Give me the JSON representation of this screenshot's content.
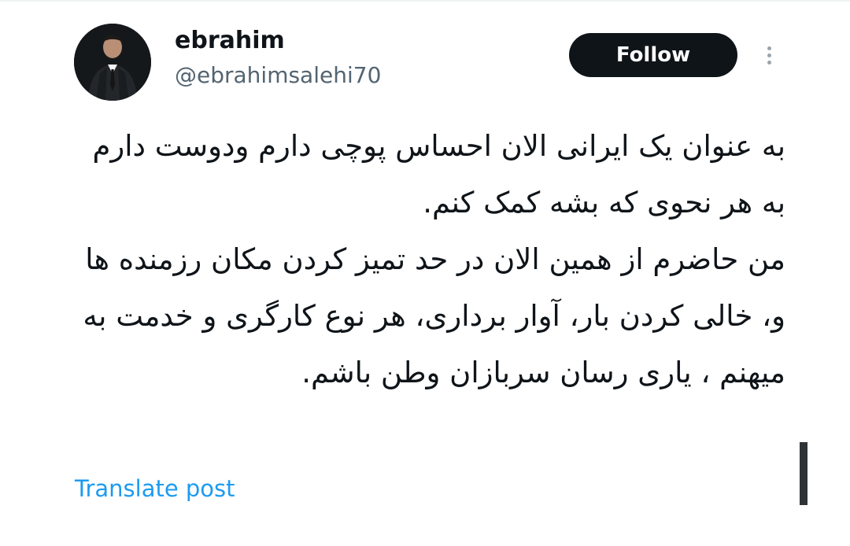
{
  "post": {
    "author": {
      "display_name": "ebrahim",
      "handle": "@ebrahimsalehi70",
      "avatar_icon": "profile-photo"
    },
    "follow_label": "Follow",
    "more_icon": "more-vertical-icon",
    "text": "به عنوان یک ایرانی الان احساس پوچی دارم ودوست دارم به هر نحوی که بشه کمک کنم.\nمن حاضرم از همین الان در حد تمیز کردن مکان رزمنده ها و، خالی کردن بار، آوار برداری، هر نوع کارگری و خدمت به میهنم ، یاری رسان سربازان وطن باشم.",
    "translate_label": "Translate post"
  },
  "colors": {
    "text": "#0f1419",
    "secondary_text": "#536471",
    "link": "#1d9bf0",
    "follow_bg": "#0f1419",
    "follow_text": "#ffffff"
  }
}
